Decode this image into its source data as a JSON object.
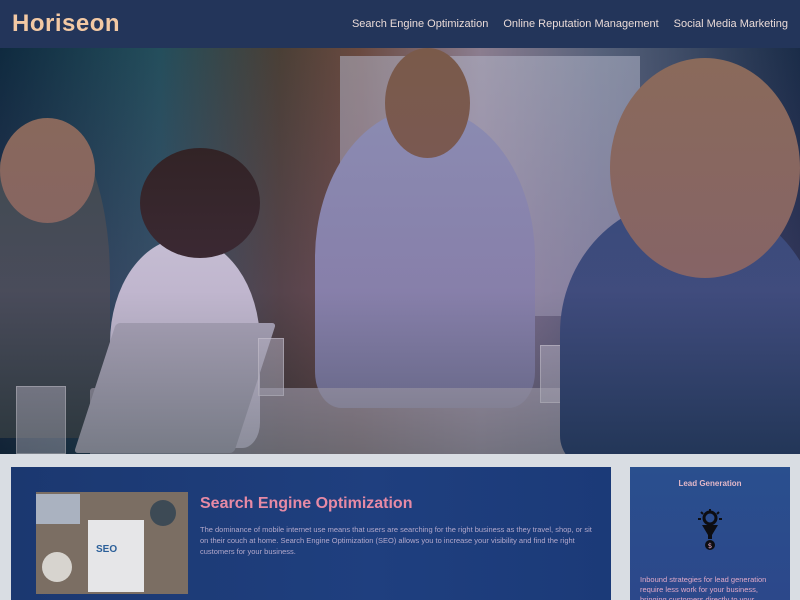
{
  "header": {
    "logo": "Horiseon",
    "nav": [
      {
        "label": "Search Engine Optimization"
      },
      {
        "label": "Online Reputation Management"
      },
      {
        "label": "Social Media Marketing"
      }
    ]
  },
  "main": {
    "seo": {
      "title": "Search Engine Optimization",
      "thumb_text": "SEO",
      "body": "The dominance of mobile internet use means that users are searching for the right business as they travel, shop, or sit on their couch at home. Search Engine Optimization (SEO) allows you to increase your visibility and find the right customers for your business."
    }
  },
  "aside": {
    "lead": {
      "title": "Lead Generation",
      "icon": "funnel-dollar-icon",
      "body": "Inbound strategies for lead generation require less work for your business, bringing customers directly to your"
    }
  },
  "colors": {
    "header_bg": "#23355a",
    "logo": "#f3c9a4",
    "card_bg": "#1f3f7f",
    "title_pink": "#e78aa5"
  }
}
